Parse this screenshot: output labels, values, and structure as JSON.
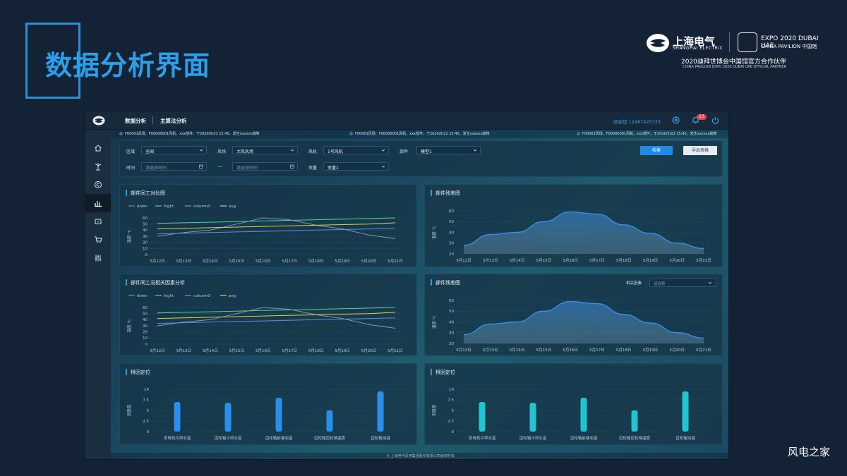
{
  "slide": {
    "title": "数据分析界面"
  },
  "brand": {
    "name_cn": "上海电气",
    "name_en": "SHANGHAI ELECTRIC",
    "expo": "EXPO 2020 DUBAI UAE",
    "pavilion": "CHINA PAVILION 中国馆",
    "partner_cn": "2020迪拜世博会中国馆官方合作伙伴",
    "partner_en": "CHINA PAVILION EXPO 2020 DUBAI UAE OFFICIAL PARTNER"
  },
  "watermark": "风电之家",
  "topbar": {
    "nav": [
      "数据分析",
      "主算法分析"
    ],
    "welcome": "欢迎您 12487425333",
    "badge": "23"
  },
  "ticker": [
    "F00001风场、F00000001风机，xxx部件，于2020/5/22 15:45，发生xxxxxx故障",
    "F00001风场、F00000001风机，xxx部件，于2020/5/22 15:45，发生xxxxxx故障",
    "F00001风场、F00000001风机，xxx部件，于2020/5/22 15:45，发生xxxxxx故障"
  ],
  "filters": {
    "region_label": "区域",
    "region_value": "全国",
    "farm_label": "风场",
    "farm_value": "大风风场",
    "turbine_label": "风机",
    "turbine_value": "1号风机",
    "part_label": "部件",
    "part_value": "模型1",
    "time_label": "时间",
    "time_start_ph": "请选择时间",
    "time_sep": "—",
    "time_end_ph": "请选择时间",
    "var_label": "变量",
    "var_value": "变量1",
    "search_label": "检索",
    "export_label": "导出表格"
  },
  "panels": {
    "p1_title": "部件同工对比图",
    "p2_title": "部件残差图",
    "p3_title": "部件同工况相关因素分析",
    "p4_title": "部件残差图",
    "p4_corr_label": "相关因素",
    "p4_corr_ph": "请选择",
    "p5_title": "根因定位",
    "p6_title": "根因定位"
  },
  "colors": {
    "accent": "#2d9ee8",
    "down": "#5a8fd8",
    "hight": "#4fd39a",
    "column0": "#8f8fb4",
    "avg": "#d8d24a",
    "area": "#3b8ee0",
    "bar_blue": "#2a8fea",
    "bar_teal": "#21c4cf"
  },
  "chart_data": [
    {
      "type": "line",
      "x": [
        "5月12日",
        "5月13日",
        "5月14日",
        "5月15日",
        "5月16日",
        "5月17日",
        "5月18日",
        "5月19日",
        "5月20日",
        "5月21日"
      ],
      "ylabel": "温度 ℃",
      "ylim": [
        0,
        60
      ],
      "yticks": [
        0,
        10,
        20,
        30,
        40,
        50,
        60
      ],
      "legend_position": "top-left",
      "series": [
        {
          "name": "down",
          "values": [
            34,
            35,
            36,
            37,
            38,
            39,
            40,
            41,
            42,
            43
          ]
        },
        {
          "name": "hight",
          "values": [
            51,
            52,
            53,
            54,
            55,
            56,
            57,
            58,
            59,
            60
          ]
        },
        {
          "name": "column0",
          "values": [
            30,
            36,
            40,
            50,
            60,
            57,
            48,
            42,
            32,
            26
          ]
        },
        {
          "name": "avg",
          "values": [
            42,
            43,
            44,
            45,
            46,
            47,
            48,
            49,
            50,
            52
          ]
        }
      ]
    },
    {
      "type": "area",
      "x": [
        "5月12日",
        "5月13日",
        "5月14日",
        "5月15日",
        "5月16日",
        "5月17日",
        "5月18日",
        "5月19日",
        "5月20日",
        "5月21日"
      ],
      "ylabel": "温度 ℃",
      "ylim": [
        20,
        60
      ],
      "yticks": [
        20,
        30,
        40,
        50,
        60
      ],
      "values": [
        28,
        38,
        40,
        50,
        59,
        57,
        47,
        39,
        30,
        25
      ]
    },
    {
      "type": "line",
      "x": [
        "5月12日",
        "5月13日",
        "5月14日",
        "5月15日",
        "5月16日",
        "5月17日",
        "5月18日",
        "5月19日",
        "5月20日",
        "5月21日"
      ],
      "ylabel": "温度 ℃",
      "ylim": [
        0,
        60
      ],
      "yticks": [
        0,
        10,
        20,
        30,
        40,
        50,
        60
      ],
      "legend_position": "top-left",
      "series": [
        {
          "name": "down",
          "values": [
            34,
            35,
            36,
            37,
            38,
            39,
            40,
            41,
            42,
            43
          ]
        },
        {
          "name": "hight",
          "values": [
            51,
            52,
            53,
            54,
            55,
            56,
            57,
            58,
            59,
            60
          ]
        },
        {
          "name": "column0",
          "values": [
            30,
            36,
            40,
            50,
            60,
            57,
            48,
            42,
            32,
            26
          ]
        },
        {
          "name": "avg",
          "values": [
            42,
            43,
            44,
            45,
            46,
            47,
            48,
            49,
            50,
            52
          ]
        }
      ]
    },
    {
      "type": "area",
      "x": [
        "5月12日",
        "5月13日",
        "5月14日",
        "5月15日",
        "5月16日",
        "5月17日",
        "5月18日",
        "5月19日",
        "5月20日",
        "5月21日"
      ],
      "ylabel": "温度 ℃",
      "ylim": [
        20,
        60
      ],
      "yticks": [
        20,
        30,
        40,
        50,
        60
      ],
      "values": [
        28,
        38,
        40,
        50,
        59,
        57,
        47,
        39,
        30,
        25
      ]
    },
    {
      "type": "bar",
      "categories": [
        "发电机冷却水温",
        "齿轮箱冷却水温",
        "齿轮箱前端油温",
        "齿轮箱齿轮轴温度",
        "齿轮箱油温"
      ],
      "values": [
        7,
        6.8,
        8,
        5,
        9.5
      ],
      "ylabel": "贡献度",
      "ylim": [
        0,
        10
      ],
      "yticks": [
        0,
        2.5,
        5,
        7.5,
        10
      ]
    },
    {
      "type": "bar",
      "categories": [
        "发电机冷却水温",
        "齿轮箱冷却水温",
        "齿轮箱前端油温",
        "齿轮箱齿轮轴温度",
        "齿轮箱油温"
      ],
      "values": [
        7,
        6.8,
        8,
        5,
        9.5
      ],
      "ylabel": "贡献度",
      "ylim": [
        0,
        10
      ],
      "yticks": [
        0,
        2.5,
        5,
        7.5,
        10
      ]
    }
  ],
  "footer": "© 上海电气风电集团股份有限公司版权所有"
}
